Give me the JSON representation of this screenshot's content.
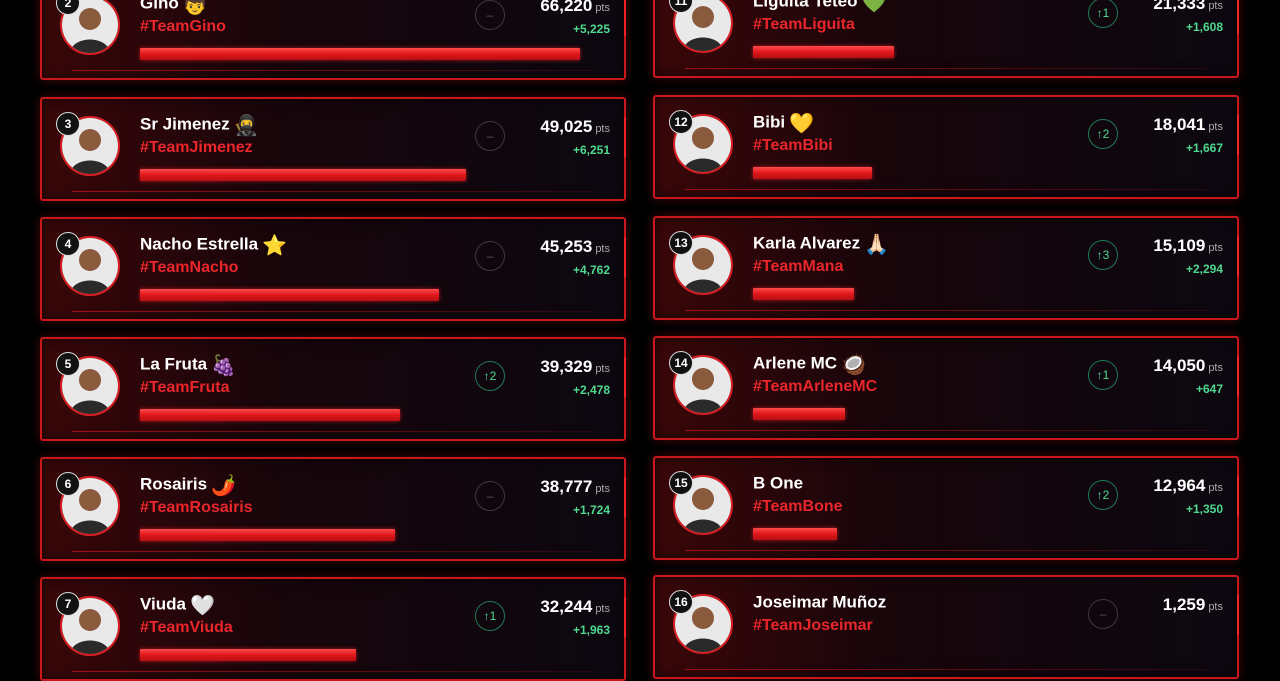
{
  "pts_unit": "pts",
  "players": [
    {
      "rank": "2",
      "name": "Gino",
      "emoji": "👦",
      "team": "#TeamGino",
      "movement": "–",
      "movement_type": "neutral",
      "points": "66,220",
      "delta": "+5,225",
      "bar_fraction": 1.0
    },
    {
      "rank": "3",
      "name": "Sr Jimenez",
      "emoji": "🥷",
      "team": "#TeamJimenez",
      "movement": "–",
      "movement_type": "neutral",
      "points": "49,025",
      "delta": "+6,251",
      "bar_fraction": 0.74
    },
    {
      "rank": "4",
      "name": "Nacho Estrella",
      "emoji": "⭐",
      "team": "#TeamNacho",
      "movement": "–",
      "movement_type": "neutral",
      "points": "45,253",
      "delta": "+4,762",
      "bar_fraction": 0.68
    },
    {
      "rank": "5",
      "name": "La Fruta",
      "emoji": "🍇",
      "team": "#TeamFruta",
      "movement": "↑2",
      "movement_type": "up",
      "points": "39,329",
      "delta": "+2,478",
      "bar_fraction": 0.59
    },
    {
      "rank": "6",
      "name": "Rosairis",
      "emoji": "🌶️",
      "team": "#TeamRosairis",
      "movement": "–",
      "movement_type": "neutral",
      "points": "38,777",
      "delta": "+1,724",
      "bar_fraction": 0.58
    },
    {
      "rank": "7",
      "name": "Viuda",
      "emoji": "🤍",
      "team": "#TeamViuda",
      "movement": "↑1",
      "movement_type": "up",
      "points": "32,244",
      "delta": "+1,963",
      "bar_fraction": 0.49
    },
    {
      "rank": "11",
      "name": "Liguita Teteo",
      "emoji": "💚",
      "team": "#TeamLiguita",
      "movement": "↑1",
      "movement_type": "up",
      "points": "21,333",
      "delta": "+1,608",
      "bar_fraction": 0.32
    },
    {
      "rank": "12",
      "name": "Bibi",
      "emoji": "💛",
      "team": "#TeamBibi",
      "movement": "↑2",
      "movement_type": "up",
      "points": "18,041",
      "delta": "+1,667",
      "bar_fraction": 0.27
    },
    {
      "rank": "13",
      "name": "Karla Alvarez",
      "emoji": "🙏🏻",
      "team": "#TeamMana",
      "movement": "↑3",
      "movement_type": "up",
      "points": "15,109",
      "delta": "+2,294",
      "bar_fraction": 0.23
    },
    {
      "rank": "14",
      "name": "Arlene MC",
      "emoji": "🥥",
      "team": "#TeamArleneMC",
      "movement": "↑1",
      "movement_type": "up",
      "points": "14,050",
      "delta": "+647",
      "bar_fraction": 0.21
    },
    {
      "rank": "15",
      "name": "B One",
      "emoji": "",
      "team": "#TeamBone",
      "movement": "↑2",
      "movement_type": "up",
      "points": "12,964",
      "delta": "+1,350",
      "bar_fraction": 0.19
    },
    {
      "rank": "16",
      "name": "Joseimar Muñoz",
      "emoji": "",
      "team": "#TeamJoseimar",
      "movement": "–",
      "movement_type": "neutral",
      "points": "1,259",
      "delta": "",
      "bar_fraction": 0.0
    }
  ],
  "colors": {
    "accent": "#e8262b",
    "positive": "#4fd98f",
    "border": "#c8181b"
  }
}
